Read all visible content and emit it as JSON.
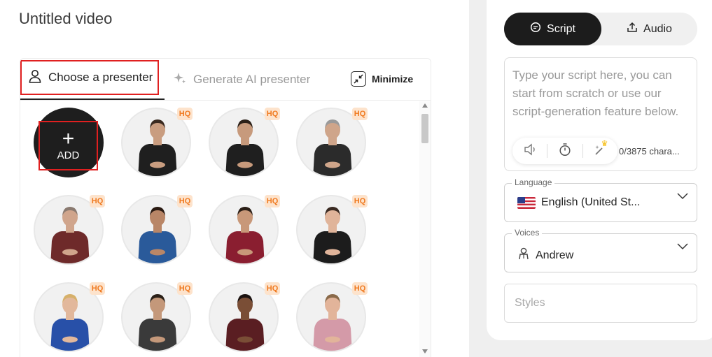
{
  "video_title": "Untitled video",
  "tabs": {
    "presenter": "Choose a presenter",
    "ai_presenter": "Generate AI presenter",
    "minimize": "Minimize"
  },
  "add_label": "ADD",
  "add_plus": "+",
  "hq_badge": "HQ",
  "presenters": [
    {
      "shirt": "#1f1f1f",
      "skin": "#c99d80",
      "hair": "#3a2a20"
    },
    {
      "shirt": "#1f1f1f",
      "skin": "#c79a7c",
      "hair": "#2b2018"
    },
    {
      "shirt": "#2b2b2b",
      "skin": "#cfa58a",
      "hair": "#9a9a9a"
    },
    {
      "shirt": "#6e2a2a",
      "skin": "#d0a58c",
      "hair": "#8a7a70"
    },
    {
      "shirt": "#2a5a9a",
      "skin": "#b98667",
      "hair": "#2a1a12"
    },
    {
      "shirt": "#8a1e30",
      "skin": "#c89879",
      "hair": "#2a1e16"
    },
    {
      "shirt": "#1c1c1c",
      "skin": "#e0b49a",
      "hair": "#3a2a22"
    },
    {
      "shirt": "#2850a8",
      "skin": "#e2b89c",
      "hair": "#d6b06a"
    },
    {
      "shirt": "#3a3a3a",
      "skin": "#c4987a",
      "hair": "#2a2018"
    },
    {
      "shirt": "#5a1e22",
      "skin": "#7a4e36",
      "hair": "#1a1210"
    },
    {
      "shirt": "#d49aa8",
      "skin": "#e2b49a",
      "hair": "#8a6a4a"
    }
  ],
  "sidebar": {
    "mode_script": "Script",
    "mode_audio": "Audio",
    "script_placeholder": "Type your script here, you can start from scratch or use our script-generation feature below.",
    "char_count": "0/3875 chara...",
    "language_legend": "Language",
    "language_value": "English (United St...",
    "voices_legend": "Voices",
    "voice_value": "Andrew",
    "styles_placeholder": "Styles"
  },
  "colors": {
    "accent_dark": "#1c1c1c",
    "highlight_red": "#e02020",
    "hq_orange": "#f07a20"
  }
}
